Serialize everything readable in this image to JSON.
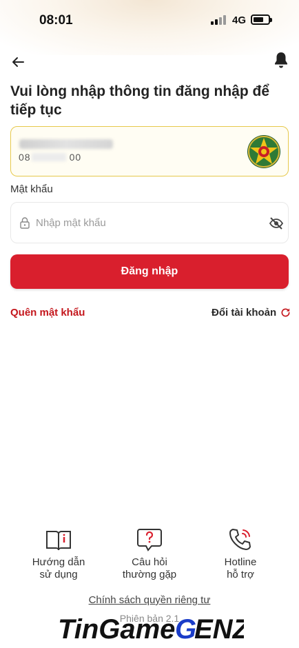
{
  "status_bar": {
    "time": "08:01",
    "network": "4G"
  },
  "header": {
    "back_icon": "arrow-left-icon",
    "bell_icon": "bell-icon"
  },
  "heading": "Vui lòng nhập thông tin đăng nhập để tiếp tục",
  "account": {
    "phone_prefix": "08",
    "phone_suffix": "00",
    "emblem_icon": "police-emblem-icon"
  },
  "password": {
    "label": "Mật khẩu",
    "placeholder": "Nhập mật khẩu",
    "lock_icon": "lock-icon",
    "eye_icon": "eye-slash-icon"
  },
  "login_button": "Đăng nhập",
  "forgot_password": "Quên mật khẩu",
  "switch_account": "Đổi tài khoản",
  "footer": {
    "items": [
      {
        "label": "Hướng dẫn\nsử dụng",
        "icon": "book-icon"
      },
      {
        "label": "Câu hỏi\nthường gặp",
        "icon": "question-bubble-icon"
      },
      {
        "label": "Hotline\nhỗ trợ",
        "icon": "phone-call-icon"
      }
    ],
    "privacy": "Chính sách quyền riêng tư",
    "version": "Phiên bản 2.1"
  },
  "watermark": "TinGameGENZ",
  "colors": {
    "primary_red": "#d91f2d",
    "link_red": "#c4161c",
    "card_border": "#e6c84a"
  }
}
